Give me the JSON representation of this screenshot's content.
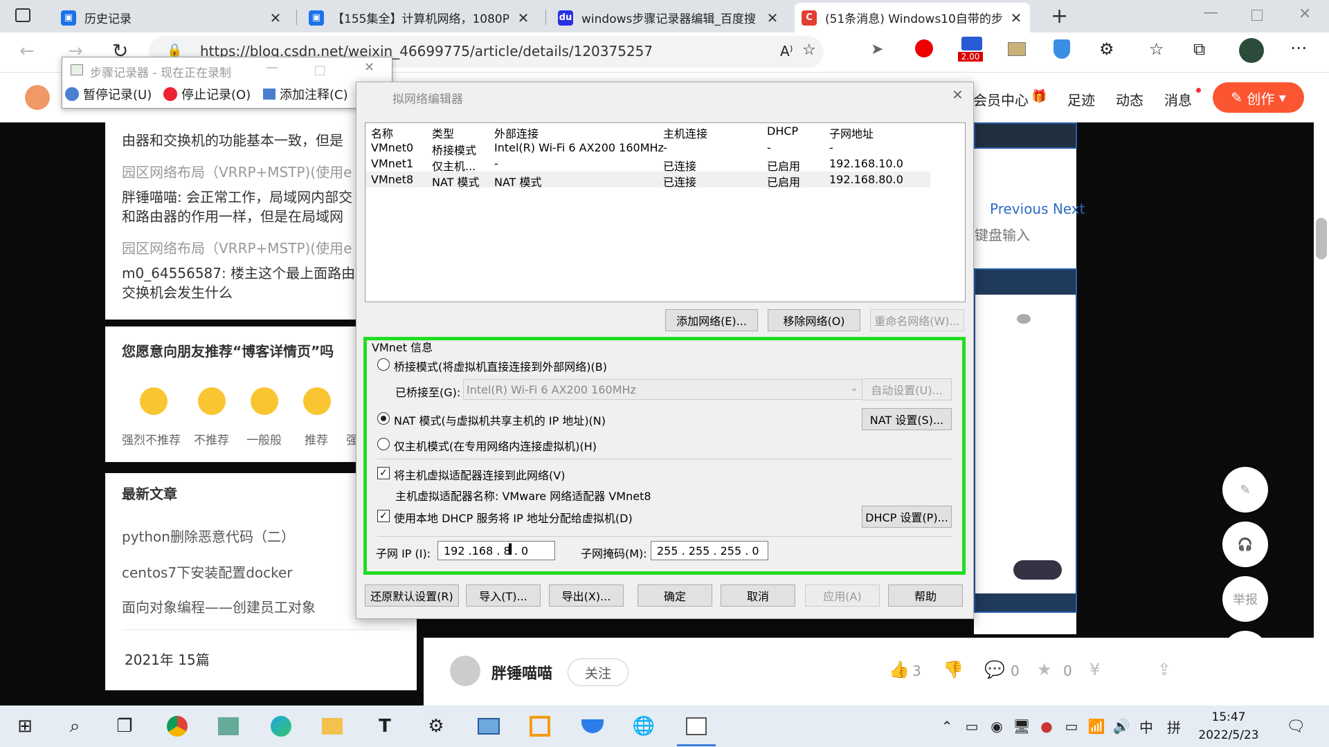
{
  "browser": {
    "tabs": [
      {
        "title": "历史记录",
        "icon": "history-icon",
        "fav_color": "#1a73e8"
      },
      {
        "title": "【155集全】计算机网络，1080P",
        "icon": "bilibili-icon",
        "fav_color": "#1a73e8"
      },
      {
        "title": "windows步骤记录器编辑_百度搜",
        "icon": "baidu-icon",
        "fav_color": "#2932e1"
      },
      {
        "title": "(51条消息) Windows10自带的步",
        "icon": "csdn-icon",
        "fav_color": "#e33e33"
      }
    ],
    "url": "https://blog.csdn.net/weixin_46699775/article/details/120375257",
    "badge": "2.00"
  },
  "steps_recorder": {
    "title": "步骤记录器 - 现在正在录制",
    "pause": "暂停记录(U)",
    "stop": "停止记录(O)",
    "comment": "添加注释(C)",
    "help": "?"
  },
  "csdn": {
    "header_items": [
      "会员中心",
      "足迹",
      "动态",
      "消息"
    ],
    "create": "创作",
    "comments": [
      "由器和交换机的功能基本一致，但是",
      "园区网络布局（VRRP+MSTP)(使用e",
      "胖锤喵喵: 会正常工作，局域网内部交",
      "和路由器的作用一样，但是在局域网",
      "园区网络布局（VRRP+MSTP)(使用e",
      "m0_64556587: 楼主这个最上面路由",
      "交换机会发生什么"
    ],
    "recommend_title": "您愿意向朋友推荐“博客详情页”吗",
    "ratings": [
      "强烈不推荐",
      "不推荐",
      "一般般",
      "推荐",
      "强"
    ],
    "latest_title": "最新文章",
    "latest": [
      "python删除恶意代码（二）",
      "centos7下安装配置docker",
      "面向对象编程——创建员工对象"
    ],
    "archive": "2021年  15篇",
    "nav_prev_next": "Previous Next",
    "keyboard": "键盘输入",
    "author": "胖锤喵喵",
    "follow": "关注",
    "likes": "3",
    "comments_count": "0",
    "stars": "0",
    "report": "举报"
  },
  "vnet": {
    "title": "拟网络编辑器",
    "columns": [
      "名称",
      "类型",
      "外部连接",
      "主机连接",
      "DHCP",
      "子网地址"
    ],
    "rows": [
      [
        "VMnet0",
        "桥接模式",
        "Intel(R) Wi-Fi 6 AX200 160MHz",
        "-",
        "-",
        "-"
      ],
      [
        "VMnet1",
        "仅主机...",
        "-",
        "已连接",
        "已启用",
        "192.168.10.0"
      ],
      [
        "VMnet8",
        "NAT 模式",
        "NAT 模式",
        "已连接",
        "已启用",
        "192.168.80.0"
      ]
    ],
    "add": "添加网络(E)...",
    "remove": "移除网络(O)",
    "rename": "重命名网络(W)...",
    "info_title": "VMnet 信息",
    "bridged": "桥接模式(将虚拟机直接连接到外部网络)(B)",
    "bridged_to_label": "已桥接至(G):",
    "bridged_to_value": "Intel(R) Wi-Fi 6 AX200 160MHz",
    "auto": "自动设置(U)...",
    "nat": "NAT 模式(与虚拟机共享主机的 IP 地址)(N)",
    "nat_settings": "NAT 设置(S)...",
    "hostonly": "仅主机模式(在专用网络内连接虚拟机)(H)",
    "connect_adapter": "将主机虚拟适配器连接到此网络(V)",
    "adapter_name": "主机虚拟适配器名称: VMware 网络适配器 VMnet8",
    "use_dhcp": "使用本地 DHCP 服务将 IP 地址分配给虚拟机(D)",
    "dhcp_settings": "DHCP 设置(P)...",
    "subnet_ip_label": "子网 IP (I):",
    "subnet_ip": "192 .168 . 8  .  0",
    "mask_label": "子网掩码(M):",
    "mask": "255 . 255 . 255 .  0",
    "restore": "还原默认设置(R)",
    "import": "导入(T)...",
    "export": "导出(X)...",
    "ok": "确定",
    "cancel": "取消",
    "apply": "应用(A)",
    "help": "帮助",
    "highlight_color": "#22dd22"
  },
  "taskbar": {
    "time": "15:47",
    "date": "2022/5/23",
    "ime1": "中",
    "ime2": "拼"
  }
}
